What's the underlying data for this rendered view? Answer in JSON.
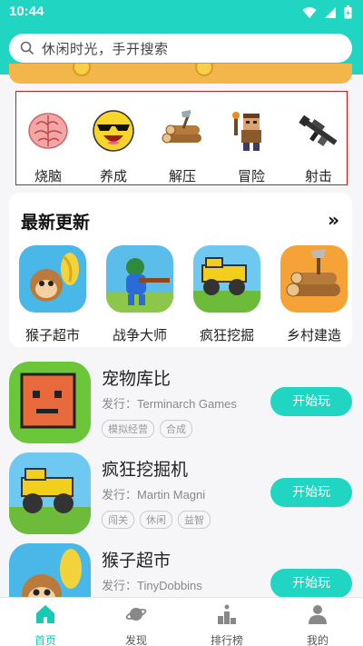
{
  "status": {
    "time": "10:44"
  },
  "search": {
    "placeholder": "休闲时光，手开搜索"
  },
  "categories": [
    {
      "label": "烧脑",
      "icon": "brain-icon"
    },
    {
      "label": "养成",
      "icon": "cool-emoji-icon"
    },
    {
      "label": "解压",
      "icon": "wood-logs-icon"
    },
    {
      "label": "冒险",
      "icon": "pixel-adventurer-icon"
    },
    {
      "label": "射击",
      "icon": "rifle-icon"
    }
  ],
  "latest": {
    "title": "最新更新",
    "more": "»",
    "items": [
      {
        "label": "猴子超市"
      },
      {
        "label": "战争大师"
      },
      {
        "label": "疯狂挖掘"
      },
      {
        "label": "乡村建造"
      }
    ]
  },
  "games": [
    {
      "name": "宠物库比",
      "dev_prefix": "发行：",
      "developer": "Terminarch Games",
      "tags": [
        "模拟经营",
        "合成"
      ],
      "button": "开始玩"
    },
    {
      "name": "疯狂挖掘机",
      "dev_prefix": "发行：",
      "developer": "Martin Magni",
      "tags": [
        "闯关",
        "休闲",
        "益智"
      ],
      "button": "开始玩"
    },
    {
      "name": "猴子超市",
      "dev_prefix": "发行：",
      "developer": "TinyDobbins",
      "tags": [],
      "button": "开始玩"
    }
  ],
  "tabs": [
    {
      "label": "首页",
      "icon": "home-icon",
      "active": true
    },
    {
      "label": "发现",
      "icon": "planet-icon"
    },
    {
      "label": "排行榜",
      "icon": "podium-icon"
    },
    {
      "label": "我的",
      "icon": "person-icon"
    }
  ],
  "colors": {
    "accent": "#20d6c2",
    "highlight_border": "#d61a1a"
  }
}
